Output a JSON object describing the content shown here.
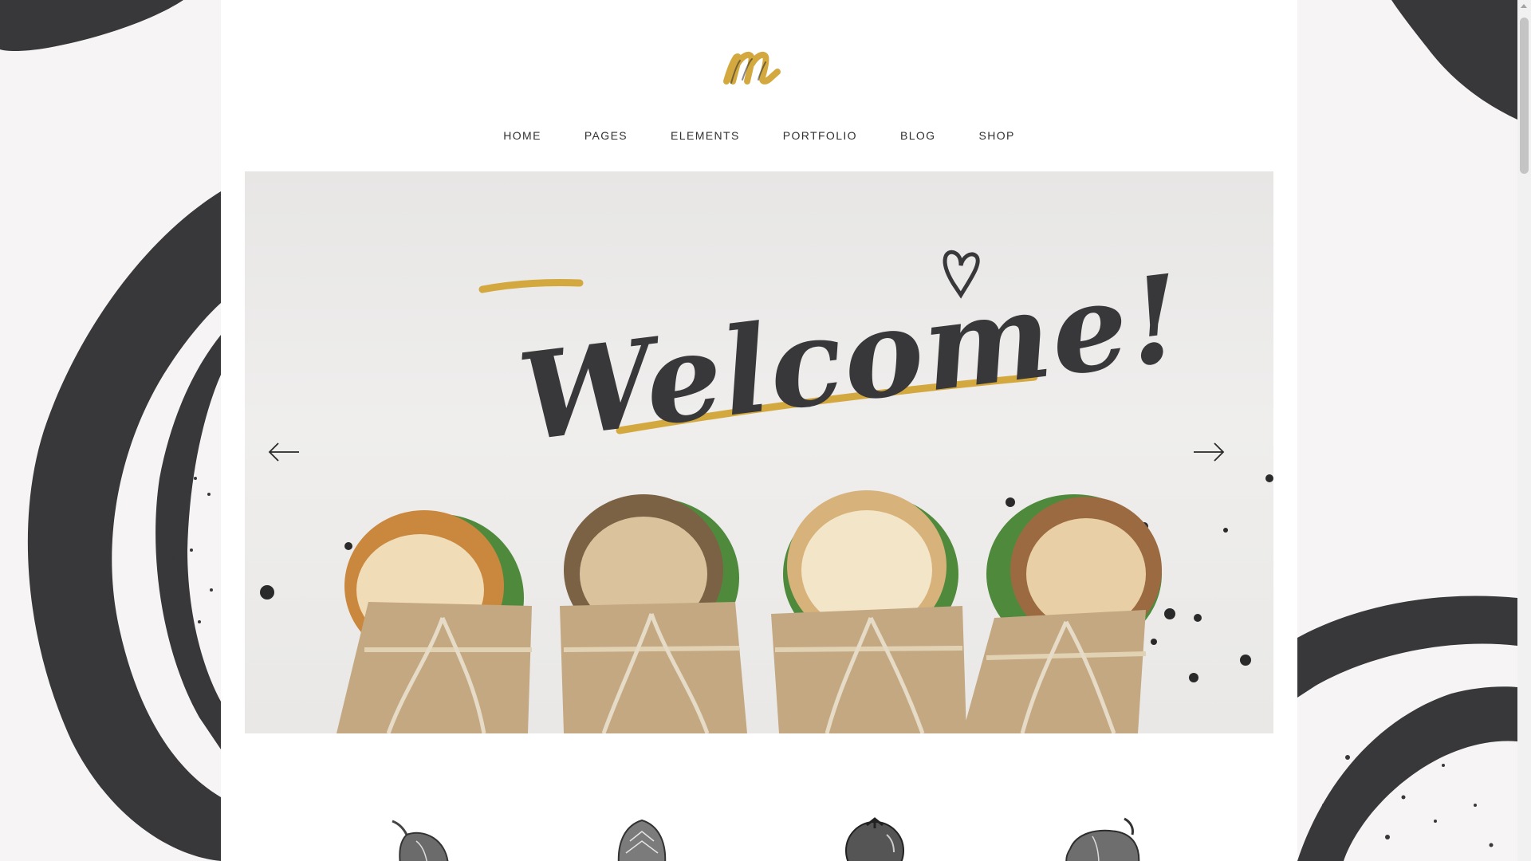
{
  "logo": {
    "letter": "m",
    "accent": "#d3a93f"
  },
  "nav": {
    "items": [
      {
        "label": "HOME"
      },
      {
        "label": "PAGES"
      },
      {
        "label": "ELEMENTS"
      },
      {
        "label": "PORTFOLIO"
      },
      {
        "label": "BLOG"
      },
      {
        "label": "SHOP"
      }
    ]
  },
  "hero": {
    "headline": "Welcome!",
    "accent_color": "#d3a93f",
    "ink_color": "#383739",
    "prev_icon": "arrow-left-icon",
    "next_icon": "arrow-right-icon"
  },
  "featured_icons": [
    "fig-icon",
    "artichoke-icon",
    "tomato-icon",
    "bell-pepper-icon"
  ],
  "colors": {
    "brush": "#383739",
    "background": "#f6f4f4",
    "page": "#ffffff"
  }
}
